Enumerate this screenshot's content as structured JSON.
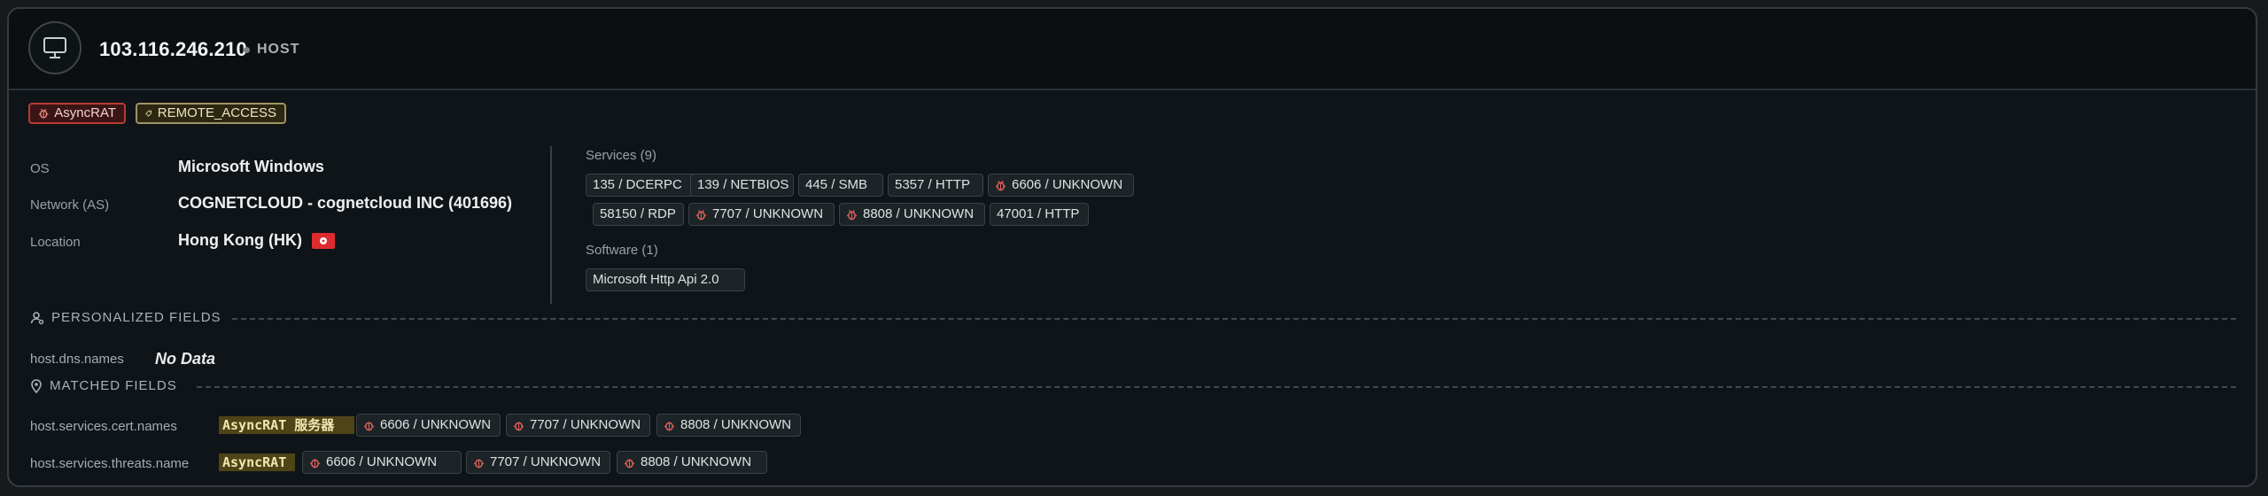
{
  "header": {
    "ip": "103.116.246.210",
    "type": "HOST",
    "icon": "monitor-icon"
  },
  "tags": {
    "threat": {
      "label": "AsyncRAT",
      "icon": "bug-icon",
      "color": "#b83a32"
    },
    "label": {
      "label": "REMOTE_ACCESS",
      "icon": "tag-icon",
      "color": "#9f9460"
    }
  },
  "info": {
    "os_label": "OS",
    "os_value": "Microsoft Windows",
    "network_label": "Network (AS)",
    "network_value": "COGNETCLOUD - cognetcloud INC (401696)",
    "location_label": "Location",
    "location_value": "Hong Kong (HK)",
    "flag": "hong-kong-flag-icon"
  },
  "services": {
    "label": "Services (9)",
    "items": [
      {
        "label": "135 / DCERPC",
        "threat": false
      },
      {
        "label": "139 / NETBIOS",
        "threat": false
      },
      {
        "label": "445 / SMB",
        "threat": false
      },
      {
        "label": "5357 / HTTP",
        "threat": false
      },
      {
        "label": "6606 / UNKNOWN",
        "threat": true
      },
      {
        "label": "58150 / RDP",
        "threat": false
      },
      {
        "label": "7707 / UNKNOWN",
        "threat": true
      },
      {
        "label": "8808 / UNKNOWN",
        "threat": true
      },
      {
        "label": "47001 / HTTP",
        "threat": false
      }
    ]
  },
  "software": {
    "label": "Software (1)",
    "items": [
      "Microsoft Http Api 2.0"
    ]
  },
  "personalized": {
    "title": "PERSONALIZED FIELDS",
    "icon": "user-pin-icon",
    "field_label": "host.dns.names",
    "field_value": "No Data"
  },
  "matched": {
    "title": "MATCHED FIELDS",
    "icon": "location-pin-icon",
    "cert_label": "host.services.cert.names",
    "cert_highlight": "AsyncRAT 服务器",
    "threat_label": "host.services.threats.name",
    "threat_highlight": "AsyncRAT",
    "cert_services": [
      "6606 / UNKNOWN",
      "7707 / UNKNOWN",
      "8808 / UNKNOWN"
    ],
    "threat_services": [
      "6606 / UNKNOWN",
      "7707 / UNKNOWN",
      "8808 / UNKNOWN"
    ]
  }
}
